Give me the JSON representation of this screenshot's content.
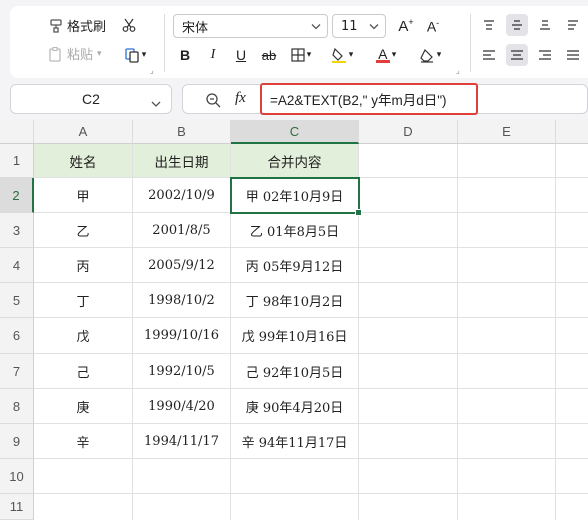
{
  "ribbon": {
    "format_painter_label": "格式刷",
    "paste_label": "粘贴",
    "font_name": "宋体",
    "font_size": "11",
    "bold": "B",
    "italic": "I",
    "underline": "U",
    "strike": "ab",
    "grow_font": "A+",
    "shrink_font": "A-",
    "font_color_glyph": "A"
  },
  "formula_bar": {
    "cell_ref": "C2",
    "fx_label": "fx",
    "formula": "=A2&TEXT(B2,\" y年m月d日\")"
  },
  "columns": [
    "A",
    "B",
    "C",
    "D",
    "E"
  ],
  "rows": [
    "1",
    "2",
    "3",
    "4",
    "5",
    "6",
    "7",
    "8",
    "9",
    "10",
    "11"
  ],
  "active_cell": {
    "col": "C",
    "row": "2"
  },
  "table": {
    "headers": [
      "姓名",
      "出生日期",
      "合并内容"
    ],
    "data": [
      [
        "甲",
        "2002/10/9",
        "甲 02年10月9日"
      ],
      [
        "乙",
        "2001/8/5",
        "乙 01年8月5日"
      ],
      [
        "丙",
        "2005/9/12",
        "丙 05年9月12日"
      ],
      [
        "丁",
        "1998/10/2",
        "丁 98年10月2日"
      ],
      [
        "戊",
        "1999/10/16",
        "戊 99年10月16日"
      ],
      [
        "己",
        "1992/10/5",
        "己 92年10月5日"
      ],
      [
        "庚",
        "1990/4/20",
        "庚 90年4月20日"
      ],
      [
        "辛",
        "1994/11/17",
        "辛 94年11月17日"
      ]
    ]
  },
  "colors": {
    "header_fill": "#e2efda",
    "selection": "#217346",
    "highlight_border": "#e0403a"
  }
}
